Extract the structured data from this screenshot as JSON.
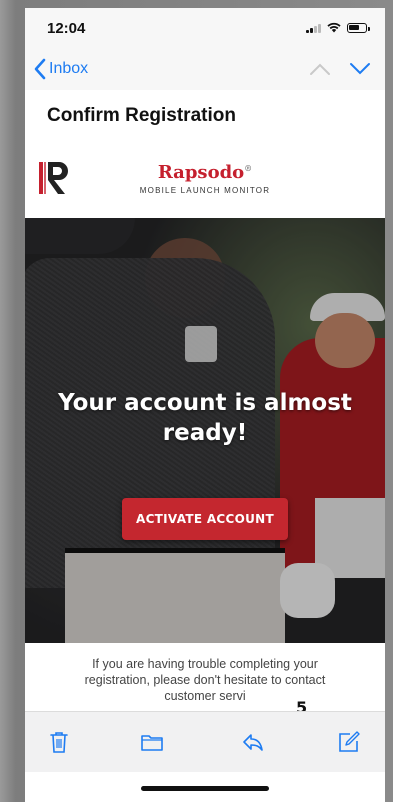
{
  "status_bar": {
    "time": "12:04"
  },
  "nav": {
    "back_label": "Inbox"
  },
  "email": {
    "subject": "Confirm Registration",
    "brand": {
      "name": "Rapsodo",
      "trademark": "®",
      "tagline": "MOBILE LAUNCH MONITOR"
    },
    "hero": {
      "headline": "Your account is almost ready!",
      "button_label": "ACTIVATE ACCOUNT"
    },
    "help_text": "If you are having trouble completing your registration, please don't hesitate to contact customer servi"
  },
  "overlay": {
    "page_number": "5"
  },
  "toolbar": {
    "icons": [
      "trash-icon",
      "folder-icon",
      "reply-icon",
      "compose-icon"
    ]
  },
  "colors": {
    "accent_blue": "#1e7cf2",
    "brand_red": "#c4272f"
  }
}
